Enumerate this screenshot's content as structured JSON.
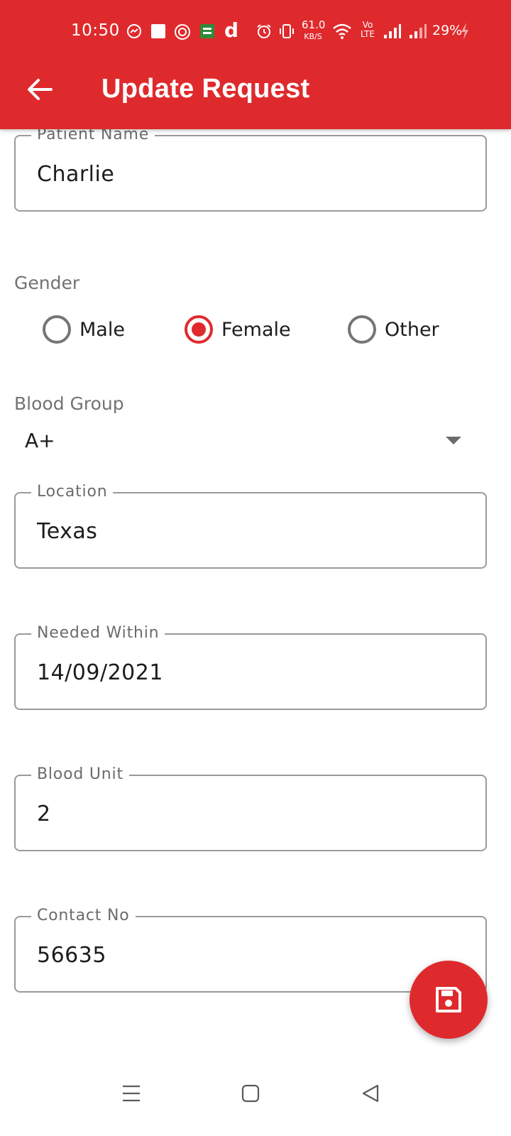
{
  "status_bar": {
    "time": "10:50",
    "net_speed": "61.0",
    "net_unit": "KB/S",
    "volte": "Vo",
    "lte": "LTE",
    "battery": "29%",
    "icons": [
      "messenger-icon",
      "notification-square-icon",
      "app-icon",
      "app-icon",
      "d-app-icon",
      "alarm-icon",
      "vibrate-icon",
      "wifi-icon",
      "signal-icon",
      "signal-icon",
      "charging-icon"
    ]
  },
  "header": {
    "title": "Update Request",
    "background_color": "#df2a2d"
  },
  "form": {
    "patient_name": {
      "label": "Patient Name",
      "value": "Charlie"
    },
    "gender": {
      "label": "Gender",
      "options": [
        "Male",
        "Female",
        "Other"
      ],
      "selected": "Female"
    },
    "blood_group": {
      "label": "Blood Group",
      "value": "A+"
    },
    "location": {
      "label": "Location",
      "value": "Texas"
    },
    "needed_within": {
      "label": "Needed Within",
      "value": "14/09/2021"
    },
    "blood_unit": {
      "label": "Blood Unit",
      "value": "2"
    },
    "contact_no": {
      "label": "Contact No",
      "value": "56635"
    }
  },
  "fab": {
    "icon": "save-icon"
  },
  "nav": {
    "icons": [
      "menu-icon",
      "home-icon",
      "back-triangle-icon"
    ]
  },
  "accent_color": "#df2a2d"
}
